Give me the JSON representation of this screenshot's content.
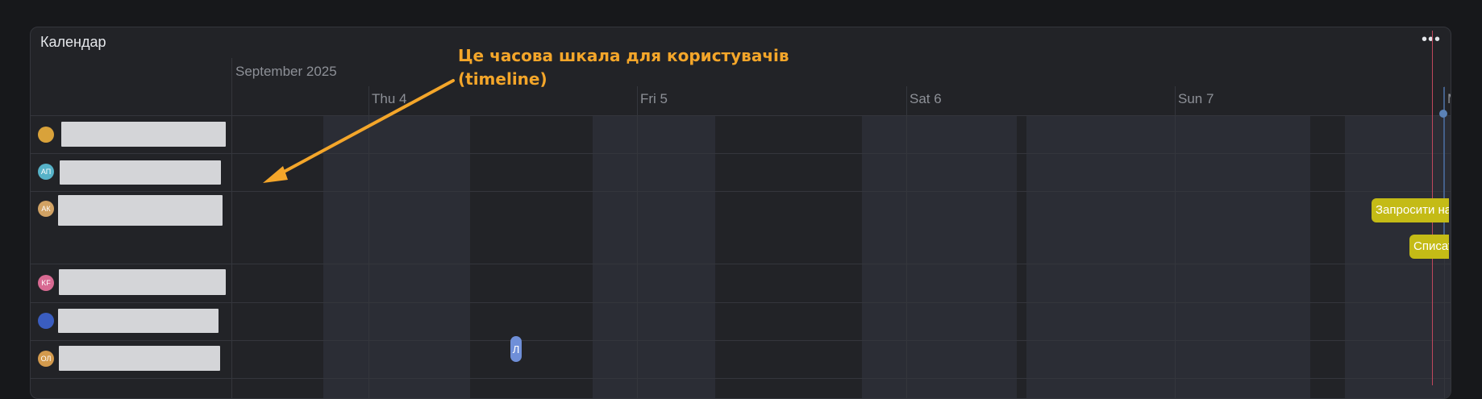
{
  "window": {
    "title": "Календар",
    "more_icon": "ellipsis-icon"
  },
  "timeline": {
    "month": "September 2025",
    "days": [
      "Thu 4",
      "Fri 5",
      "Sat 6",
      "Sun 7",
      "M"
    ]
  },
  "users": [
    {
      "initials": "",
      "avatar_color": "#d9a23a"
    },
    {
      "initials": "АП",
      "avatar_color": "#56b2c8"
    },
    {
      "initials": "АК",
      "avatar_color": "#d1a264"
    },
    {
      "initials": "KF",
      "avatar_color": "#d86a92"
    },
    {
      "initials": "",
      "avatar_color": "#3a5dc0"
    },
    {
      "initials": "ОЛ",
      "avatar_color": "#d39a4d"
    }
  ],
  "events": [
    {
      "label": "Запросити на",
      "color": "#c4bb16"
    },
    {
      "label": "Списат",
      "color": "#c4bb16"
    },
    {
      "label": "Л",
      "color": "#6f8fd8"
    }
  ],
  "annotation": {
    "line1": "Це часова шкала для користувачів",
    "line2": "(timeline)",
    "color": "#f4a62a"
  }
}
